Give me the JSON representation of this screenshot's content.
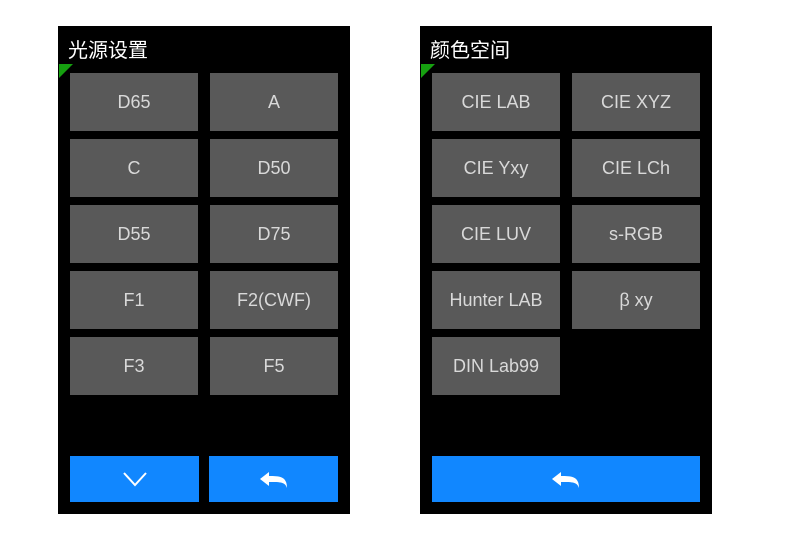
{
  "panels": {
    "left": {
      "title": "光源设置",
      "options": [
        "D65",
        "A",
        "C",
        "D50",
        "D55",
        "D75",
        "F1",
        "F2(CWF)",
        "F3",
        "F5"
      ],
      "footer": {
        "down": true,
        "back": true
      }
    },
    "right": {
      "title": "颜色空间",
      "options": [
        "CIE LAB",
        "CIE XYZ",
        "CIE Yxy",
        "CIE LCh",
        "CIE LUV",
        "s-RGB",
        "Hunter LAB",
        "β xy",
        "DIN Lab99"
      ],
      "footer": {
        "back_full": true
      }
    }
  },
  "colors": {
    "accent": "#1187ff",
    "button_bg": "#595959",
    "button_fg": "#d9d9d9",
    "indicator": "#16a010"
  }
}
